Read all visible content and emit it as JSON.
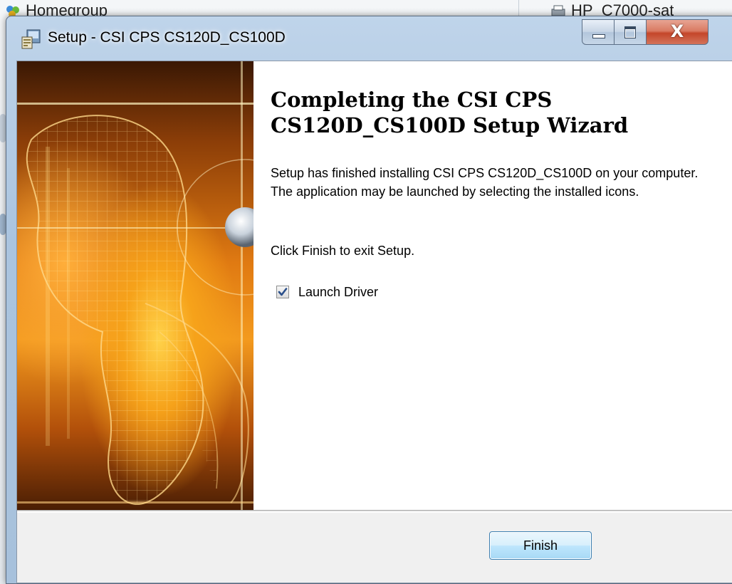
{
  "desktop": {
    "left_item": "Homegroup",
    "right_item": "HP_C7000-sat"
  },
  "window": {
    "title": "Setup - CSI CPS CS120D_CS100D",
    "app_icon": "setup-installer-icon",
    "caption_buttons": {
      "minimize_icon": "minimize-icon",
      "maximize_icon": "maximize-icon",
      "close_icon": "close-icon",
      "close_glyph": "X"
    }
  },
  "wizard": {
    "heading": "Completing the CSI CPS CS120D_CS100D Setup Wizard",
    "paragraph1": "Setup has finished installing CSI CPS CS120D_CS100D on your computer. The application may be launched by selecting the installed icons.",
    "paragraph2": "Click Finish to exit Setup.",
    "launch_checkbox": {
      "label": "Launch Driver",
      "checked": true
    },
    "finish_button": "Finish"
  },
  "colors": {
    "accent": "#3c7fb1",
    "banner_orange": "#f39a1e",
    "close_red": "#c4462a"
  }
}
